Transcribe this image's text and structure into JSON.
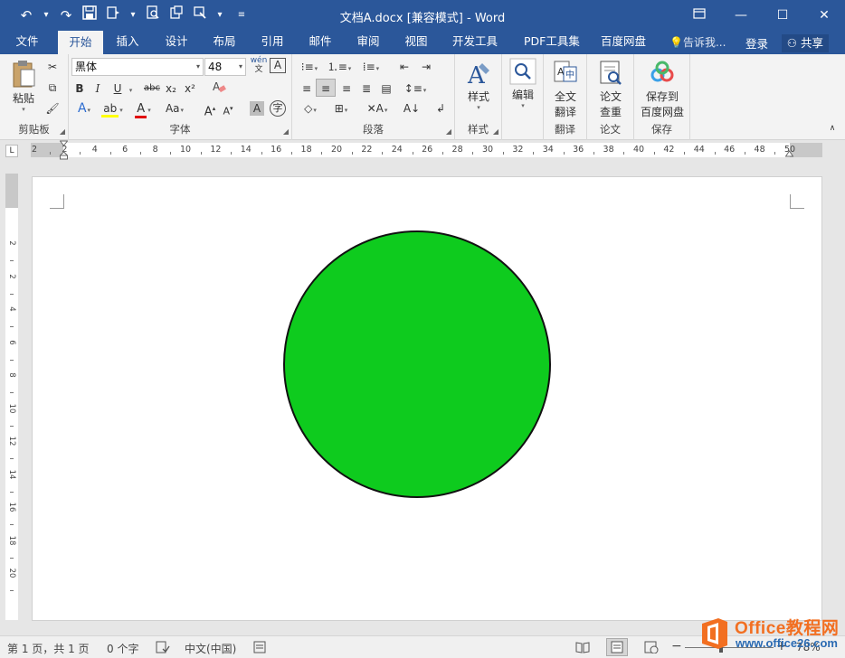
{
  "window": {
    "title": "文档A.docx [兼容模式] - Word",
    "qat_icons": [
      "undo-icon",
      "redo-icon",
      "save-icon",
      "touch-mode-icon",
      "print-preview-icon",
      "new-icon",
      "format-painter-icon",
      "customize-icon"
    ],
    "controls": [
      "ribbon-display-icon",
      "minimize-icon",
      "maximize-icon",
      "close-icon"
    ]
  },
  "tabs": [
    "文件",
    "开始",
    "插入",
    "设计",
    "布局",
    "引用",
    "邮件",
    "审阅",
    "视图",
    "开发工具",
    "PDF工具集",
    "百度网盘"
  ],
  "active_tab": "开始",
  "tell_me": "告诉我...",
  "login": "登录",
  "share": "共享",
  "ribbon": {
    "clipboard": {
      "label": "剪贴板",
      "paste": "粘贴"
    },
    "font": {
      "label": "字体",
      "font_name": "黑体",
      "font_size": "48",
      "phonetic": "wén",
      "bold": "B",
      "italic": "I",
      "underline": "U",
      "strike": "abc",
      "subscript": "x₂",
      "superscript": "x²",
      "change_case": "Aa",
      "grow": "A",
      "shrink": "A"
    },
    "paragraph": {
      "label": "段落"
    },
    "styles": {
      "label": "样式",
      "button": "样式"
    },
    "editing": {
      "button": "编辑"
    },
    "translate": {
      "label": "翻译",
      "button_line1": "全文",
      "button_line2": "翻译"
    },
    "paper": {
      "label": "论文",
      "button_line1": "论文",
      "button_line2": "查重"
    },
    "save": {
      "label": "保存",
      "button_line1": "保存到",
      "button_line2": "百度网盘"
    }
  },
  "ruler": {
    "corner": "L",
    "h_numbers": [
      "2",
      "2",
      "4",
      "6",
      "8",
      "10",
      "12",
      "14",
      "16",
      "18",
      "20",
      "22",
      "24",
      "26",
      "28",
      "30",
      "32",
      "34",
      "36",
      "38",
      "40",
      "42",
      "44",
      "46",
      "48",
      "50"
    ],
    "v_numbers": [
      "2",
      "2",
      "4",
      "6",
      "8",
      "10",
      "12",
      "14",
      "16",
      "18",
      "20"
    ]
  },
  "document": {
    "shape": {
      "type": "circle",
      "fill": "#0ecb1e",
      "stroke": "#111111"
    }
  },
  "status": {
    "page": "第 1 页，共 1 页",
    "words": "0 个字",
    "language": "中文(中国)",
    "zoom": "78%"
  },
  "watermark": {
    "title": "Office教程网",
    "url": "www.office26.com"
  },
  "colors": {
    "accent": "#2b579a",
    "ribbon_bg": "#f3f3f3",
    "watermark_orange": "#f26f21"
  }
}
